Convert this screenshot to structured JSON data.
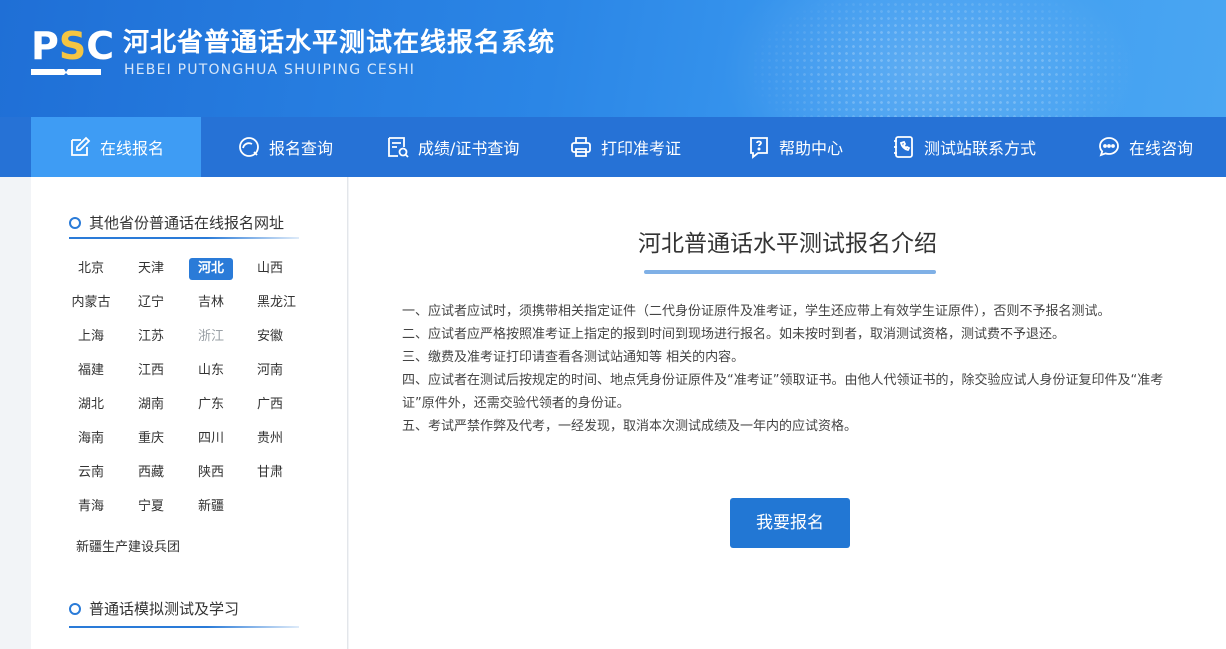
{
  "header": {
    "logo_text": "PSC",
    "title": "河北省普通话水平测试在线报名系统",
    "subtitle": "HEBEI PUTONGHUA SHUIPING CESHI"
  },
  "nav": {
    "items": [
      {
        "label": "在线报名",
        "icon": "edit-icon",
        "active": true
      },
      {
        "label": "报名查询",
        "icon": "search-circle-icon"
      },
      {
        "label": "成绩/证书查询",
        "icon": "certificate-search-icon"
      },
      {
        "label": "打印准考证",
        "icon": "printer-icon"
      },
      {
        "label": "帮助中心",
        "icon": "help-icon"
      },
      {
        "label": "测试站联系方式",
        "icon": "phone-book-icon"
      },
      {
        "label": "在线咨询",
        "icon": "chat-icon"
      }
    ]
  },
  "sidebar": {
    "section1_title": "其他省份普通话在线报名网址",
    "provinces": [
      [
        "北京",
        "天津",
        "河北",
        "山西"
      ],
      [
        "内蒙古",
        "辽宁",
        "吉林",
        "黑龙江"
      ],
      [
        "上海",
        "江苏",
        "浙江",
        "安徽"
      ],
      [
        "福建",
        "江西",
        "山东",
        "河南"
      ],
      [
        "湖北",
        "湖南",
        "广东",
        "广西"
      ],
      [
        "海南",
        "重庆",
        "四川",
        "贵州"
      ],
      [
        "云南",
        "西藏",
        "陕西",
        "甘肃"
      ],
      [
        "青海",
        "宁夏",
        "新疆"
      ]
    ],
    "selected_province": "河北",
    "dimmed_province": "浙江",
    "extra_item": "新疆生产建设兵团",
    "section2_title": "普通话模拟测试及学习"
  },
  "main": {
    "title": "河北普通话水平测试报名介绍",
    "rules": [
      "一、应试者应试时，须携带相关指定证件（二代身份证原件及准考证，学生还应带上有效学生证原件），否则不予报名测试。",
      "二、应试者应严格按照准考证上指定的报到时间到现场进行报名。如未按时到者，取消测试资格，测试费不予退还。",
      "三、缴费及准考证打印请查看各测试站通知等 相关的内容。",
      "四、应试者在测试后按规定的时间、地点凭身份证原件及“准考证”领取证书。由他人代领证书的，除交验应试人身份证复印件及“准考证”原件外，还需交验代领者的身份证。",
      "五、考试严禁作弊及代考，一经发现，取消本次测试成绩及一年内的应试资格。"
    ],
    "apply_button": "我要报名"
  },
  "colors": {
    "header_blue": "#2672d6",
    "nav_active": "#3e9cf4",
    "accent": "#2a7bd8",
    "logo_yellow": "#f5c542"
  }
}
